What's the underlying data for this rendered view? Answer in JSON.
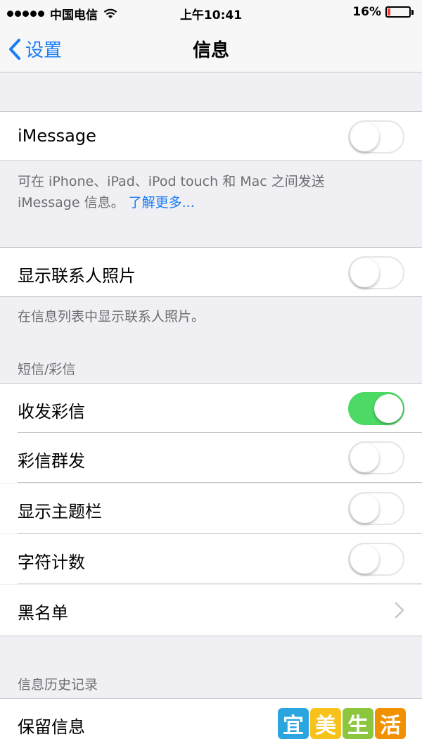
{
  "status_bar": {
    "carrier": "中国电信",
    "time": "上午10:41",
    "battery": "16%",
    "battery_level": 0.16,
    "icons": [
      "signal-dots-icon",
      "wifi-icon",
      "battery-icon"
    ]
  },
  "nav": {
    "back_label": "设置",
    "title": "信息",
    "back_icon": "chevron-left-icon"
  },
  "imessage": {
    "label": "iMessage",
    "on": false,
    "footer_text": "可在 iPhone、iPad、iPod touch 和 Mac 之间发送",
    "footer_text2": "iMessage 信息。",
    "footer_link": "了解更多..."
  },
  "contact_photos": {
    "label": "显示联系人照片",
    "on": false,
    "footer": "在信息列表中显示联系人照片。"
  },
  "sms_section": {
    "header": "短信/彩信",
    "items": [
      {
        "label": "收发彩信",
        "on": true
      },
      {
        "label": "彩信群发",
        "on": false
      },
      {
        "label": "显示主题栏",
        "on": false
      },
      {
        "label": "字符计数",
        "on": false
      },
      {
        "label": "黑名单",
        "chevron": true
      }
    ]
  },
  "history_section": {
    "header": "信息历史记录",
    "items": [
      {
        "label": "保留信息"
      }
    ]
  },
  "watermark": {
    "chars": [
      "宜",
      "美",
      "生",
      "活"
    ],
    "colors": [
      "#2aa5e0",
      "#f7c21c",
      "#8cc63f",
      "#f29100"
    ]
  },
  "colors": {
    "accent": "#1a7cf5",
    "toggle_on": "#4cd964",
    "background": "#efeff4"
  }
}
